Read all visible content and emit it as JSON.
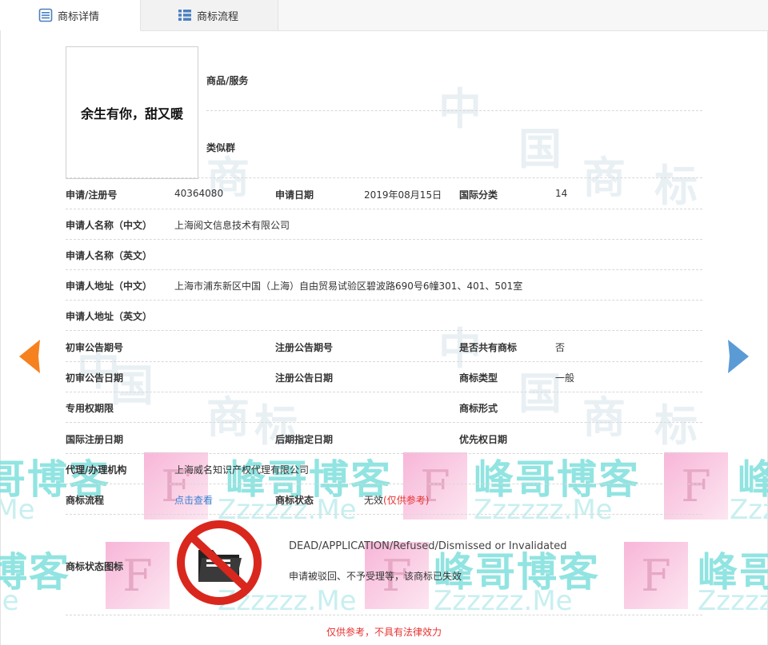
{
  "tabs": [
    {
      "label": "商标详情",
      "icon": "document-list-icon"
    },
    {
      "label": "商标流程",
      "icon": "grid-list-icon"
    }
  ],
  "mark_image_text": "余生有你，甜又暖",
  "top_labels": {
    "goods": "商品/服务",
    "similar": "类似群"
  },
  "fields": {
    "reg_no_label": "申请/注册号",
    "reg_no": "40364080",
    "apply_date_label": "申请日期",
    "apply_date": "2019年08月15日",
    "intl_class_label": "国际分类",
    "intl_class": "14",
    "applicant_cn_label": "申请人名称（中文）",
    "applicant_cn": "上海阅文信息技术有限公司",
    "applicant_en_label": "申请人名称（英文）",
    "address_cn_label": "申请人地址（中文）",
    "address_cn": "上海市浦东新区中国（上海）自由贸易试验区碧波路690号6幢301、401、501室",
    "address_en_label": "申请人地址（英文）",
    "prelim_no_label": "初审公告期号",
    "reg_pub_no_label": "注册公告期号",
    "shared_label": "是否共有商标",
    "shared": "否",
    "prelim_date_label": "初审公告日期",
    "reg_pub_date_label": "注册公告日期",
    "mark_type_label": "商标类型",
    "mark_type": "一般",
    "exclusive_label": "专用权期限",
    "mark_form_label": "商标形式",
    "intl_reg_label": "国际注册日期",
    "later_label": "后期指定日期",
    "priority_label": "优先权日期",
    "agent_label": "代理/办理机构",
    "agent": "上海威名知识产权代理有限公司",
    "process_label": "商标流程",
    "process_link": "点击查看",
    "status_label": "商标状态",
    "status": "无效",
    "status_note": "(仅供参考)",
    "status_icon_label": "商标状态图标"
  },
  "status_en": "DEAD/APPLICATION/Refused/Dismissed or Invalidated",
  "status_cn": "申请被驳回、不予受理等，该商标已失效",
  "footer": "仅供参考，不具有法律效力",
  "watermark": {
    "chars": [
      "中",
      "国",
      "商",
      "标"
    ],
    "blog": "峰哥博客",
    "z": "Zzzzzz.Me",
    "f": "F"
  },
  "colors": {
    "accent_orange": "#f5821f",
    "accent_blue": "#5b9bd5",
    "status_red": "#e7312f",
    "link_blue": "#3b80d1"
  }
}
